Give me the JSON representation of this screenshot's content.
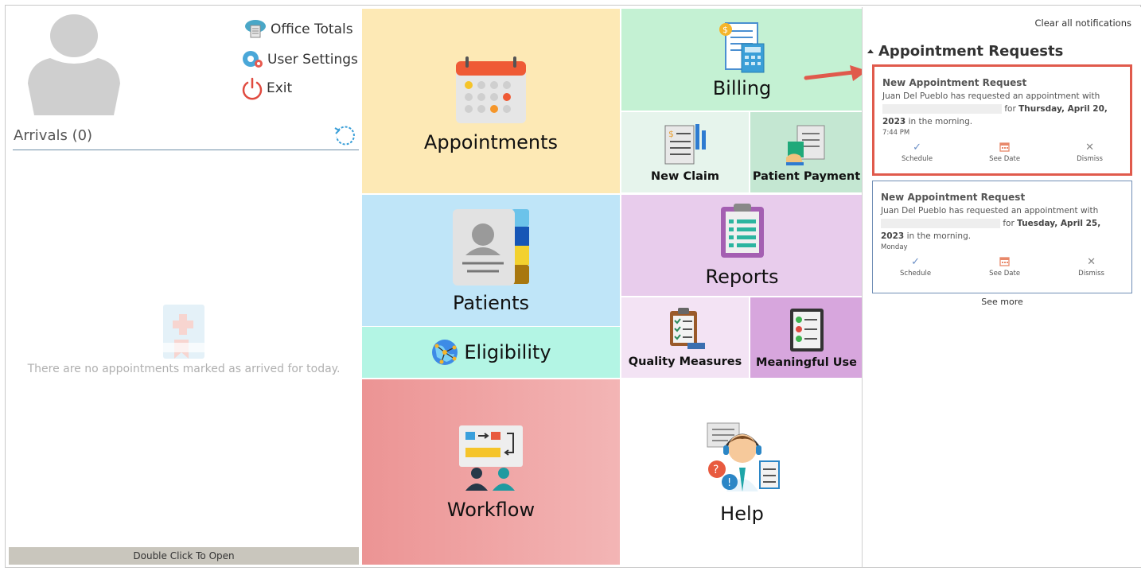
{
  "menu": {
    "office_totals": "Office Totals",
    "user_settings": "User Settings",
    "exit": "Exit"
  },
  "arrivals": {
    "title": "Arrivals (0)",
    "empty_text": "There are no appointments marked as arrived for today.",
    "open_label": "Double Click To Open"
  },
  "tiles": {
    "appointments": "Appointments",
    "billing": "Billing",
    "new_claim": "New Claim",
    "patient_payment": "Patient Payment",
    "patients": "Patients",
    "eligibility": "Eligibility",
    "reports": "Reports",
    "quality_measures": "Quality Measures",
    "meaningful_use": "Meaningful Use",
    "workflow": "Workflow",
    "help": "Help"
  },
  "notifications": {
    "clear_all": "Clear all notifications",
    "section_title": "Appointment Requests",
    "see_more": "See more",
    "cards": [
      {
        "title": "New Appointment Request",
        "name": "Juan  Del Pueblo",
        "text": "has requested an appointment with",
        "for_label": "for",
        "date": "Thursday, April 20, 2023",
        "tail": "in the morning.",
        "time": "7:44 PM",
        "actions": [
          "Schedule",
          "See Date",
          "Dismiss"
        ]
      },
      {
        "title": "New Appointment Request",
        "name": "Juan  Del Pueblo",
        "text": "has requested an appointment with",
        "for_label": "for",
        "date": "Tuesday, April 25, 2023",
        "tail": "in the morning.",
        "time": "Monday",
        "actions": [
          "Schedule",
          "See Date",
          "Dismiss"
        ]
      }
    ]
  },
  "colors": {
    "appointments_bg": "#fde9b5",
    "billing_bg": "#c4f1d3",
    "patients_bg": "#bfe5f8",
    "eligibility_bg": "#b3f5e4",
    "reports_bg": "#e8ccec",
    "meaningful_bg": "#d7a6dd",
    "workflow_bg": "#ec9494",
    "highlight": "#e05a4c"
  }
}
